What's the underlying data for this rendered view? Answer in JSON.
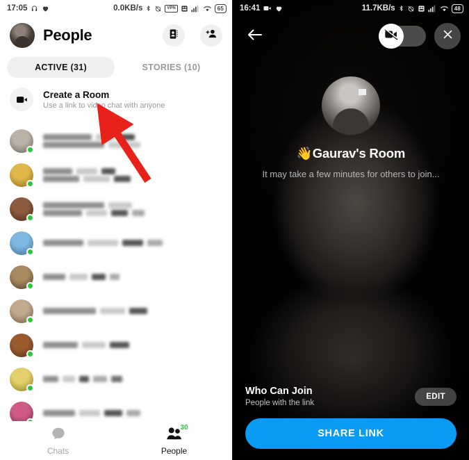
{
  "left": {
    "status_bar": {
      "time": "17:05",
      "icons_left": [
        "headphone-icon",
        "heart-icon"
      ],
      "data_rate": "0.0KB/s",
      "icons_right": [
        "bluetooth-icon",
        "alarm-off-icon",
        "vpn-icon",
        "sim-icon",
        "signal-icon",
        "wifi-icon"
      ],
      "vpn_label": "VPN",
      "battery": "65"
    },
    "header": {
      "title": "People",
      "avatar": "user-avatar",
      "buttons": [
        {
          "name": "contacts-book-button",
          "icon": "address-book-icon"
        },
        {
          "name": "add-person-button",
          "icon": "person-add-icon"
        }
      ]
    },
    "tabs": [
      {
        "label": "ACTIVE (31)",
        "active": true
      },
      {
        "label": "STORIES (10)",
        "active": false
      }
    ],
    "create_room": {
      "icon": "video-camera-icon",
      "title": "Create a Room",
      "subtitle": "Use a link to video chat with anyone"
    },
    "contacts": [
      {
        "name_redacted": true,
        "online": true,
        "avatar_colors": [
          "#b9b2a6",
          "#6a625a"
        ],
        "blur_widths": [
          [
            70,
            28,
            22
          ],
          [
            88,
            46
          ]
        ]
      },
      {
        "name_redacted": true,
        "online": true,
        "avatar_colors": [
          "#e0b84a",
          "#8a6a1f"
        ],
        "blur_widths": [
          [
            42,
            30,
            20
          ],
          [
            52,
            38,
            24
          ]
        ]
      },
      {
        "name_redacted": true,
        "online": true,
        "avatar_colors": [
          "#8c5a3c",
          "#4a2b1a"
        ],
        "blur_widths": [
          [
            88,
            34
          ],
          [
            56,
            30,
            24,
            18
          ]
        ]
      },
      {
        "name_redacted": true,
        "online": true,
        "avatar_colors": [
          "#7eb7e0",
          "#3d6f95"
        ],
        "blur_widths": [
          [
            58,
            44,
            30,
            22
          ]
        ]
      },
      {
        "name_redacted": true,
        "online": true,
        "avatar_colors": [
          "#a88a60",
          "#4b3c27"
        ],
        "blur_widths": [
          [
            32,
            26,
            20,
            14
          ]
        ]
      },
      {
        "name_redacted": true,
        "online": true,
        "avatar_colors": [
          "#c0a98d",
          "#6d5a44"
        ],
        "blur_widths": [
          [
            76,
            36,
            26
          ]
        ]
      },
      {
        "name_redacted": true,
        "online": true,
        "avatar_colors": [
          "#9b5b2f",
          "#56301a"
        ],
        "blur_widths": [
          [
            50,
            34,
            28
          ]
        ]
      },
      {
        "name_redacted": true,
        "online": true,
        "avatar_colors": [
          "#e3d06a",
          "#8c7a26"
        ],
        "blur_widths": [
          [
            22,
            18,
            14,
            20,
            16
          ]
        ]
      },
      {
        "name_redacted": true,
        "online": true,
        "avatar_colors": [
          "#d05a86",
          "#6d2b45"
        ],
        "blur_widths": [
          [
            46,
            30,
            26,
            20
          ]
        ]
      },
      {
        "name_redacted": true,
        "online": true,
        "avatar_colors": [
          "#5f86c4",
          "#2e4570"
        ],
        "blur_widths": [
          [
            30,
            26,
            40
          ]
        ]
      }
    ],
    "annotation": {
      "type": "arrow",
      "color": "#e8221b",
      "points_to": "create-a-room-row"
    },
    "bottom_nav": [
      {
        "label": "Chats",
        "icon": "chat-bubble-icon",
        "active": false,
        "badge": null
      },
      {
        "label": "People",
        "icon": "people-icon",
        "active": true,
        "badge": "30"
      }
    ]
  },
  "right": {
    "status_bar": {
      "time": "16:41",
      "icons_left": [
        "video-camera-icon",
        "heart-icon"
      ],
      "data_rate": "11.7KB/s",
      "icons_right": [
        "bluetooth-icon",
        "alarm-off-icon",
        "sim-icon",
        "signal-icon",
        "wifi-icon"
      ],
      "battery": "48"
    },
    "top_bar": {
      "back_icon": "arrow-left-icon",
      "video_toggle": {
        "icon": "video-off-icon",
        "state": "off"
      },
      "close_icon": "close-x-icon"
    },
    "room": {
      "avatar": "room-host-avatar",
      "wave_emoji": "👋",
      "title": "Gaurav's Room",
      "subtitle": "It may take a few minutes for others to join..."
    },
    "who_can_join": {
      "title": "Who Can Join",
      "subtitle": "People with the link",
      "edit_label": "EDIT"
    },
    "share_button": {
      "label": "SHARE LINK",
      "color": "#0a9bf5"
    }
  }
}
